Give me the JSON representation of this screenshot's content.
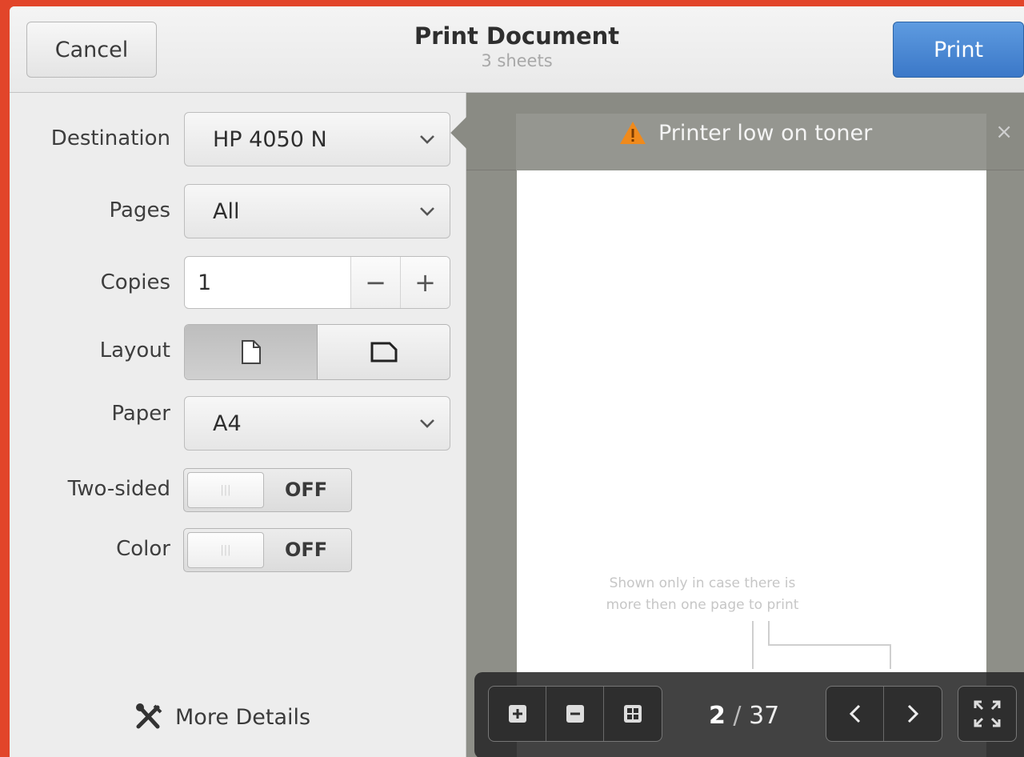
{
  "header": {
    "title": "Print Document",
    "subtitle": "3 sheets",
    "cancel_label": "Cancel",
    "print_label": "Print"
  },
  "settings": {
    "destination": {
      "label": "Destination",
      "value": "HP 4050 N"
    },
    "pages": {
      "label": "Pages",
      "value": "All"
    },
    "copies": {
      "label": "Copies",
      "value": "1",
      "minus": "−",
      "plus": "+"
    },
    "layout": {
      "label": "Layout",
      "options": [
        "portrait",
        "landscape"
      ],
      "selected": "portrait"
    },
    "paper": {
      "label": "Paper",
      "value": "A4"
    },
    "two_sided": {
      "label": "Two-sided",
      "state": "OFF"
    },
    "color": {
      "label": "Color",
      "state": "OFF"
    },
    "more_details": "More Details"
  },
  "preview": {
    "infobar_message": "Printer low on toner",
    "close_glyph": "×",
    "note": "Shown only in case there is more then one page to print",
    "current_page": "2",
    "page_separator": "/",
    "total_pages": "37"
  },
  "colors": {
    "accent": "#4a86d4",
    "warning": "#f08a1c",
    "background": "#e2452a"
  }
}
